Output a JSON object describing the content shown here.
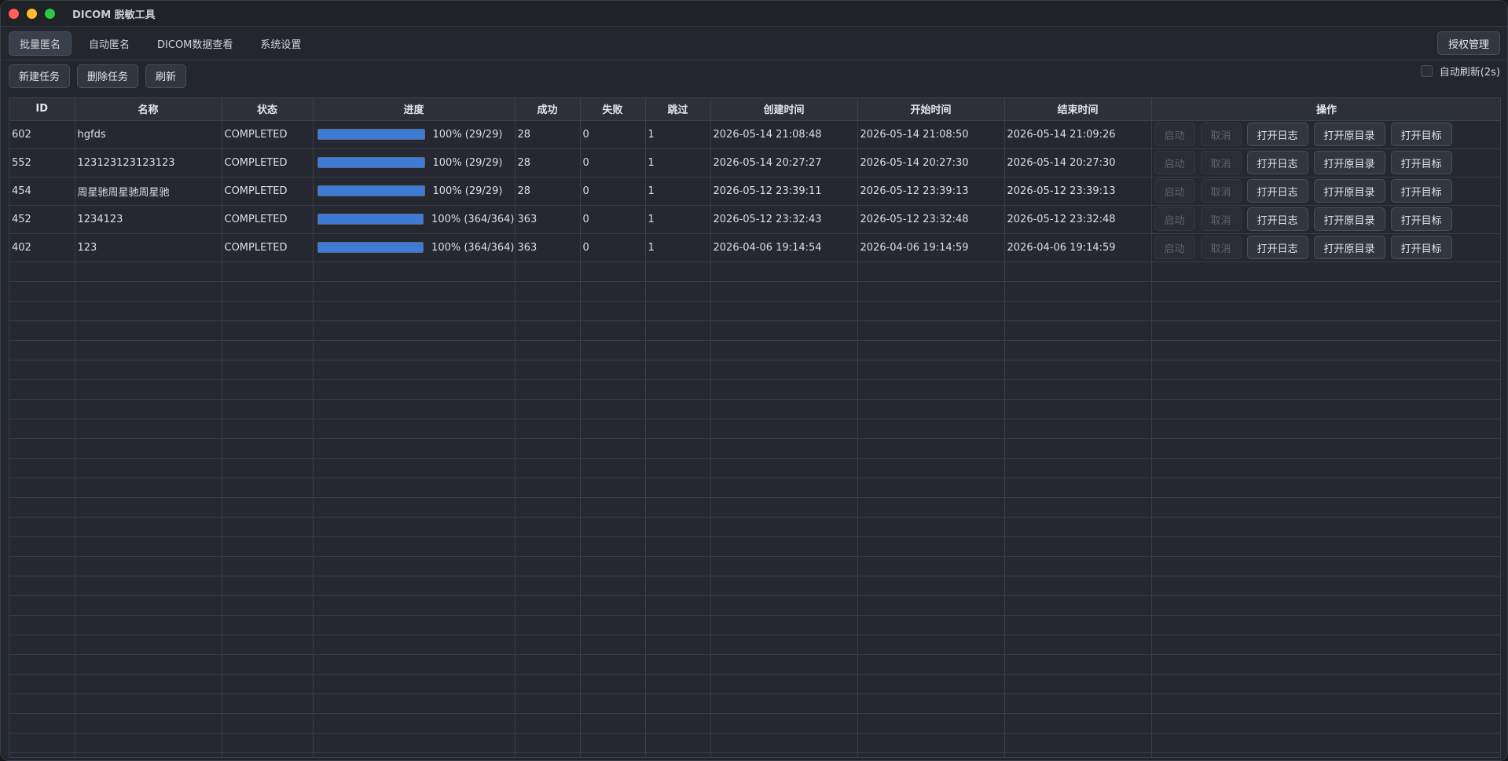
{
  "window": {
    "title": "DICOM 脱敏工具"
  },
  "tabs": [
    {
      "label": "批量匿名",
      "active": true
    },
    {
      "label": "自动匿名",
      "active": false
    },
    {
      "label": "DICOM数据查看",
      "active": false
    },
    {
      "label": "系统设置",
      "active": false
    }
  ],
  "license_button": "授权管理",
  "toolbar": {
    "new_task": "新建任务",
    "delete_task": "删除任务",
    "refresh": "刷新",
    "auto_refresh_label": "自动刷新(2s)",
    "auto_refresh_checked": false
  },
  "columns": [
    "ID",
    "名称",
    "状态",
    "进度",
    "成功",
    "失败",
    "跳过",
    "创建时间",
    "开始时间",
    "结束时间",
    "操作"
  ],
  "row_actions": {
    "start": "启动",
    "cancel": "取消",
    "open_log": "打开日志",
    "open_source": "打开原目录",
    "open_target": "打开目标"
  },
  "rows": [
    {
      "id": "602",
      "name": "hgfds",
      "status": "COMPLETED",
      "progress": 1.0,
      "progress_text": "100% (29/29)",
      "success": "28",
      "failed": "0",
      "skipped": "1",
      "created": "2026-05-14 21:08:48",
      "started": "2026-05-14 21:08:50",
      "ended": "2026-05-14 21:09:26"
    },
    {
      "id": "552",
      "name": "123123123123123",
      "status": "COMPLETED",
      "progress": 1.0,
      "progress_text": "100% (29/29)",
      "success": "28",
      "failed": "0",
      "skipped": "1",
      "created": "2026-05-14 20:27:27",
      "started": "2026-05-14 20:27:30",
      "ended": "2026-05-14 20:27:30"
    },
    {
      "id": "454",
      "name": "周星驰周星驰周星驰",
      "status": "COMPLETED",
      "progress": 1.0,
      "progress_text": "100% (29/29)",
      "success": "28",
      "failed": "0",
      "skipped": "1",
      "created": "2026-05-12 23:39:11",
      "started": "2026-05-12 23:39:13",
      "ended": "2026-05-12 23:39:13"
    },
    {
      "id": "452",
      "name": "1234123",
      "status": "COMPLETED",
      "progress": 1.0,
      "progress_text": "100% (364/364)",
      "success": "363",
      "failed": "0",
      "skipped": "1",
      "created": "2026-05-12 23:32:43",
      "started": "2026-05-12 23:32:48",
      "ended": "2026-05-12 23:32:48"
    },
    {
      "id": "402",
      "name": "123",
      "status": "COMPLETED",
      "progress": 1.0,
      "progress_text": "100% (364/364)",
      "success": "363",
      "failed": "0",
      "skipped": "1",
      "created": "2026-04-06 19:14:54",
      "started": "2026-04-06 19:14:59",
      "ended": "2026-04-06 19:14:59"
    }
  ],
  "colors": {
    "progress_fill": "#3d7bd6",
    "background": "#23262d"
  }
}
